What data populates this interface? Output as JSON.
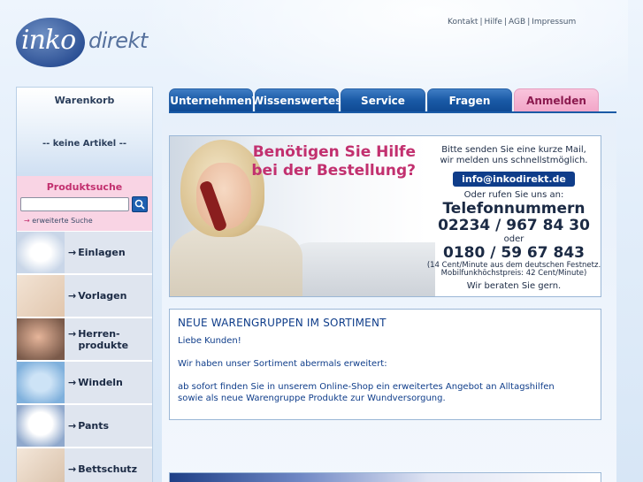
{
  "logo": {
    "part1": "inko",
    "part2": "direkt"
  },
  "top_links": [
    "Kontakt",
    "Hilfe",
    "AGB",
    "Impressum"
  ],
  "nav": {
    "tabs": [
      {
        "label": "Unternehmen"
      },
      {
        "label": "Wissenswertes"
      },
      {
        "label": "Service"
      },
      {
        "label": "Fragen"
      },
      {
        "label": "Anmelden"
      }
    ]
  },
  "sidebar": {
    "cart": {
      "title": "Warenkorb",
      "empty": "-- keine Artikel --"
    },
    "search": {
      "title": "Produktsuche",
      "value": "",
      "advanced": "erweiterte Suche"
    },
    "categories": [
      {
        "label": "Einlagen"
      },
      {
        "label": "Vorlagen"
      },
      {
        "label": "Herren-",
        "label2": "produkte"
      },
      {
        "label": "Windeln"
      },
      {
        "label": "Pants"
      },
      {
        "label": "Bettschutz"
      }
    ]
  },
  "banner": {
    "headline1": "Benötigen Sie Hilfe",
    "headline2": "bei der Bestellung?",
    "intro1": "Bitte senden Sie eine kurze Mail,",
    "intro2": "wir melden uns schnellstmöglich.",
    "mail": "info@inkodirekt.de",
    "call": "Oder rufen Sie uns an:",
    "phones_label": "Telefonnummern",
    "phone1": "02234 / 967 84 30",
    "or": "oder",
    "phone2": "0180 / 59 67 843",
    "price1": "(14 Cent/Minute aus dem deutschen Festnetz.",
    "price2": "Mobilfunkhöchstpreis: 42 Cent/Minute)",
    "closing": "Wir beraten Sie gern."
  },
  "news": {
    "title": "NEUE WARENGRUPPEN IM SORTIMENT",
    "greeting": "Liebe Kunden!",
    "para1": "Wir haben unser Sortiment abermals erweitert:",
    "para2": "ab sofort finden Sie in unserem Online-Shop ein erweitertes Angebot an Alltagshilfen",
    "para3": "sowie als neue Warengruppe Produkte zur Wundversorgung."
  },
  "colors": {
    "brand_blue": "#1a5aa6",
    "brand_pink": "#c2306f",
    "tab_pink": "#f2a6c8"
  }
}
